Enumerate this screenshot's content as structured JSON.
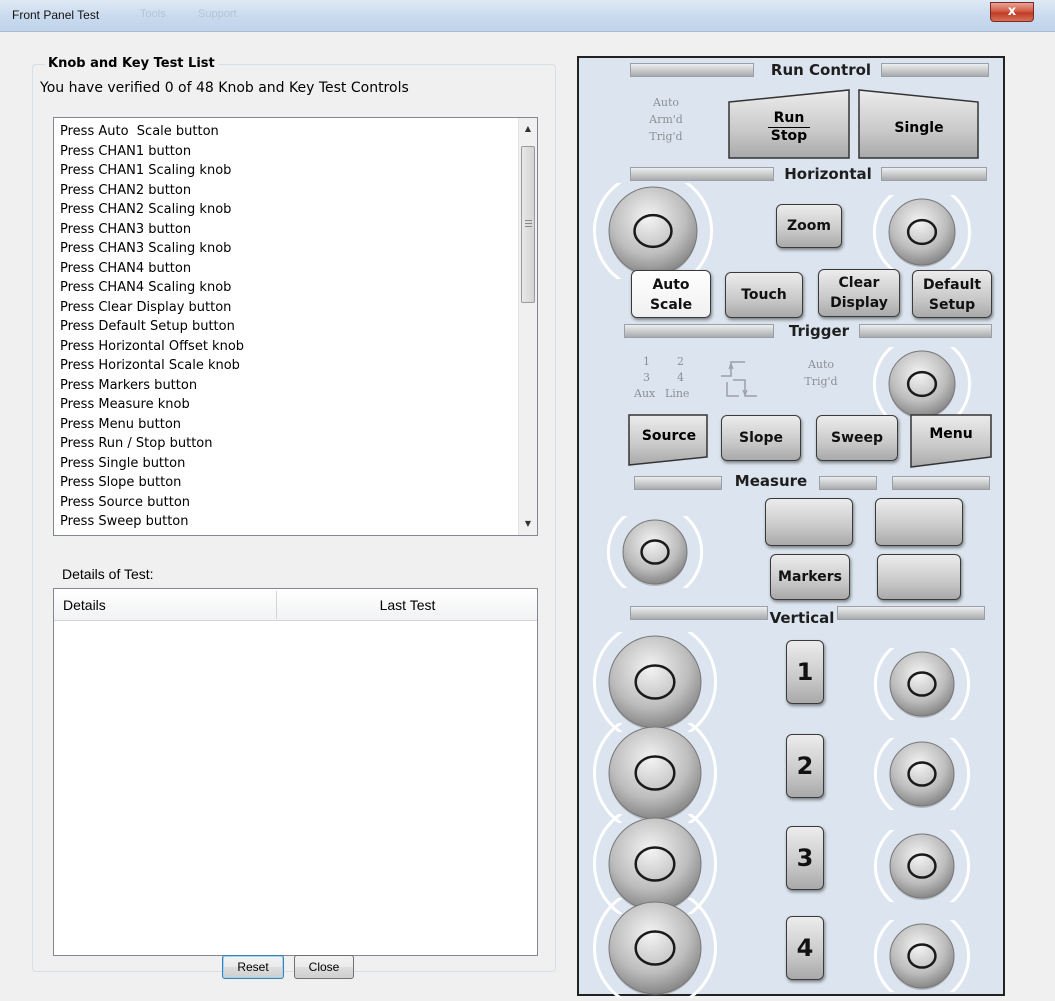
{
  "window": {
    "title": "Front Panel Test",
    "menu_ghost": [
      "Tools",
      "Support"
    ],
    "close_glyph": "x"
  },
  "test_list": {
    "legend": "Knob and Key Test List",
    "verified_text": "You have verified 0 of 48 Knob and Key Test Controls",
    "items": [
      "Press Auto  Scale button",
      "Press CHAN1 button",
      "Press CHAN1 Scaling knob",
      "Press CHAN2 button",
      "Press CHAN2 Scaling knob",
      "Press CHAN3 button",
      "Press CHAN3 Scaling knob",
      "Press CHAN4 button",
      "Press CHAN4 Scaling knob",
      "Press Clear Display button",
      "Press Default Setup button",
      "Press Horizontal Offset knob",
      "Press Horizontal Scale knob",
      "Press Markers button",
      "Press Measure knob",
      "Press Menu button",
      "Press Run / Stop button",
      "Press Single button",
      "Press Slope button",
      "Press Source button",
      "Press Sweep button"
    ]
  },
  "details": {
    "label": "Details of Test:",
    "columns": [
      "Details",
      "Last Test"
    ]
  },
  "buttons": {
    "reset": "Reset",
    "close": "Close"
  },
  "panel": {
    "run_control": {
      "title": "Run Control",
      "status": [
        "Auto",
        "Arm'd",
        "Trig'd"
      ],
      "run_top": "Run",
      "run_bottom": "Stop",
      "single": "Single"
    },
    "horizontal": {
      "title": "Horizontal",
      "zoom": "Zoom",
      "auto_scale": [
        "Auto",
        "Scale"
      ],
      "touch": "Touch",
      "clear_display": [
        "Clear",
        "Display"
      ],
      "default_setup": [
        "Default",
        "Setup"
      ]
    },
    "trigger": {
      "title": "Trigger",
      "sources": [
        "1",
        "2",
        "3",
        "4",
        "Aux",
        "Line"
      ],
      "status": [
        "Auto",
        "Trig'd"
      ],
      "source": "Source",
      "slope": "Slope",
      "sweep": "Sweep",
      "menu": "Menu"
    },
    "measure": {
      "title": "Measure",
      "markers": "Markers"
    },
    "vertical": {
      "title": "Vertical",
      "channels": [
        "1",
        "2",
        "3",
        "4"
      ]
    }
  }
}
